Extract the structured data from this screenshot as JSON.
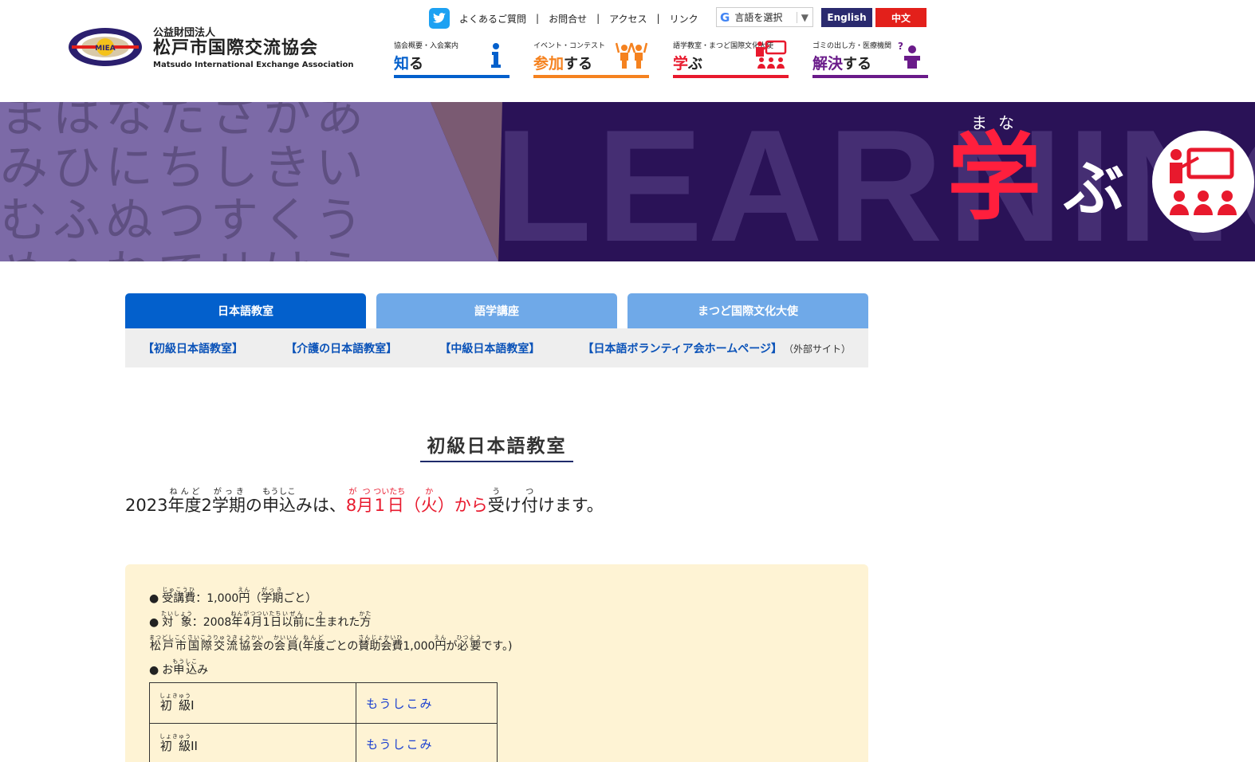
{
  "header": {
    "logo": {
      "mark_text": "MIEA",
      "legal": "公益財団法人",
      "name": "松戸市国際交流協会",
      "english": "Matsudo International Exchange Association"
    },
    "top_links": [
      "よくあるご質問",
      "お問合せ",
      "アクセス",
      "リンク"
    ],
    "translate_label": "言語を選択",
    "lang_buttons": {
      "english": "English",
      "chinese": "中文"
    },
    "nav": [
      {
        "small": "協会概要・入会案内",
        "hl": "知",
        "rest": "る",
        "color": "#0360cc",
        "icon": "info-icon"
      },
      {
        "small": "イベント・コンテスト",
        "hl": "参加",
        "rest": "する",
        "color": "#f5821f",
        "icon": "people-cheer-icon"
      },
      {
        "small": "語学教室・まつど国際文化大使",
        "hl": "学",
        "rest": "ぶ",
        "color": "#e8192d",
        "icon": "classroom-icon"
      },
      {
        "small": "ゴミの出し方・医療機関",
        "hl": "解決",
        "rest": "する",
        "color": "#6a1b8a",
        "icon": "question-person-icon"
      }
    ]
  },
  "hero": {
    "kana_lines": [
      "まはなたさかあ",
      "みひにちしきい",
      "むふぬつすくう",
      "めへねてせけえ"
    ],
    "bg_word": "LEARNING",
    "ruby": "まな",
    "kanji": "学",
    "kana": "ぶ"
  },
  "tabs": [
    {
      "label": "日本語教室",
      "active": true
    },
    {
      "label": "語学講座",
      "active": false
    },
    {
      "label": "まつど国際文化大使",
      "active": false
    }
  ],
  "subnav": [
    {
      "label": "【初級日本語教室】"
    },
    {
      "label": "【介護の日本語教室】"
    },
    {
      "label": "【中級日本語教室】"
    },
    {
      "label": "【日本語ボランティア会ホームページ】",
      "note": "（外部サイト）"
    }
  ],
  "page_title": "初級日本語教室",
  "notice": {
    "year": "2023",
    "nendo": "年度",
    "nendo_rt": "ねんど",
    "num": "2",
    "gakki": "学期",
    "gakki_rt": "がっき",
    "no": "の",
    "moushikomi": "申込",
    "moushikomi_rt": "もうしこ",
    "mi_wa": "みは、",
    "date_month": "8月",
    "date_month_rt": "がつ",
    "date_day": "1日",
    "date_day_rt": "ついたち",
    "paren_open": "（",
    "weekday": "火",
    "weekday_rt": "か",
    "paren_close": "）から",
    "uke": "受",
    "uke_rt": "う",
    "ke": "け",
    "tsuke": "付",
    "tsuke_rt": "つ",
    "end": "けます。"
  },
  "info": {
    "fee_label": "受講費",
    "fee_rt": "じゅこうひ",
    "fee_value": "：1,000",
    "fee_yen": "円",
    "fee_yen_rt": "えん",
    "fee_paren": "（",
    "fee_term": "学期",
    "fee_term_rt": "がっき",
    "fee_end": "ごと）",
    "target_label": "対 象",
    "target_rt": "たいしょう",
    "target_value": "：2008",
    "target_year": "年",
    "target_year_rt": "ねん",
    "target_date": "4月1日",
    "target_date_rt": "がつついたち",
    "target_izen": "以前",
    "target_izen_rt": "いぜん",
    "target_ni": "に",
    "target_sei": "生",
    "target_sei_rt": "う",
    "target_mareta": "まれた",
    "target_kata": "方",
    "target_kata_rt": "かた",
    "member_org": "松戸市国際交流協会",
    "member_org_rt": "まつどしこくさいこうりゅうきょうかい",
    "member_no": "の",
    "member_kaiin": "会員",
    "member_kaiin_rt": "かいいん",
    "member_paren": "(",
    "member_nendo": "年度",
    "member_nendo_rt": "ねんど",
    "member_goto": "ごとの",
    "member_sanjo": "賛助会費",
    "member_sanjo_rt": "さんじょかいひ",
    "member_fee": "1,000",
    "member_yen": "円",
    "member_yen_rt": "えん",
    "member_ga": "が",
    "member_hitsuyou": "必要",
    "member_hitsuyou_rt": "ひつよう",
    "member_end": "です。)",
    "apply_o": "お",
    "apply_label": "申込",
    "apply_rt": "もうしこ",
    "apply_mi": "み"
  },
  "apply_table": [
    {
      "level_kanji": "初 級",
      "level_rt": "しょきゅう",
      "level_num": "I",
      "link": "もうしこみ"
    },
    {
      "level_kanji": "初 級",
      "level_rt": "しょきゅう",
      "level_num": "II",
      "link": "もうしこみ"
    }
  ],
  "colors": {
    "accent_blue": "#0360cc",
    "red": "#e8192d",
    "hero_bg": "#2a1257",
    "info_bg": "#fef3d4"
  }
}
